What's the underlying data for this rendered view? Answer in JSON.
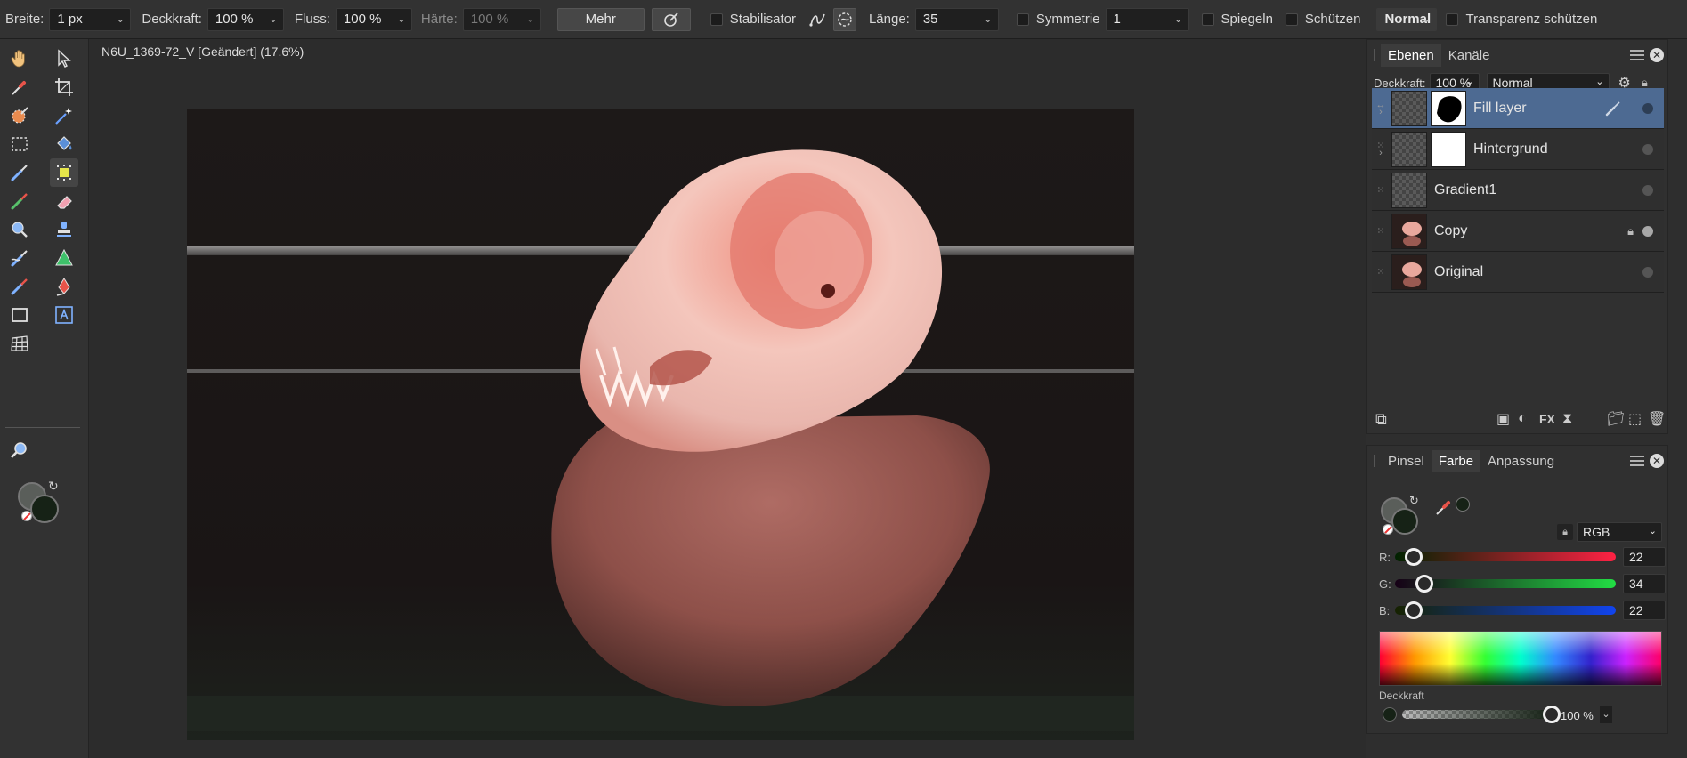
{
  "context_toolbar": {
    "width_label": "Breite:",
    "width_value": "1 px",
    "opacity_label": "Deckkraft:",
    "opacity_value": "100 %",
    "flow_label": "Fluss:",
    "flow_value": "100 %",
    "hardness_label": "Härte:",
    "hardness_value": "100 %",
    "more_label": "Mehr",
    "stabilizer_label": "Stabilisator",
    "length_label": "Länge:",
    "length_value": "35",
    "symmetry_label": "Symmetrie",
    "symmetry_value": "1",
    "mirror_label": "Spiegeln",
    "protect_label": "Schützen",
    "blend_mode": "Normal",
    "protect_alpha_label": "Transparenz schützen"
  },
  "document": {
    "title": "N6U_1369-72_V [Geändert] (17.6%)"
  },
  "layers_panel": {
    "tabs": [
      "Ebenen",
      "Kanäle"
    ],
    "opacity_label": "Deckkraft:",
    "opacity_value": "100 %",
    "blend_mode": "Normal",
    "layers": [
      {
        "name": "Fill layer",
        "selected": true,
        "visible": true,
        "locked": false
      },
      {
        "name": "Hintergrund",
        "selected": false,
        "visible": false,
        "locked": false
      },
      {
        "name": "Gradient1",
        "selected": false,
        "visible": false,
        "locked": false
      },
      {
        "name": "Copy",
        "selected": false,
        "visible": true,
        "locked": true
      },
      {
        "name": "Original",
        "selected": false,
        "visible": false,
        "locked": false
      }
    ]
  },
  "color_panel": {
    "tabs": [
      "Pinsel",
      "Farbe",
      "Anpassung"
    ],
    "model": "RGB",
    "r_label": "R:",
    "g_label": "G:",
    "b_label": "B:",
    "r_value": "22",
    "g_value": "34",
    "b_value": "22",
    "r_fraction": 0.086,
    "g_fraction": 0.133,
    "b_fraction": 0.086,
    "opacity_label": "Deckkraft",
    "opacity_value": "100 %",
    "primary_color": "#162216",
    "secondary_color": "#5a5e5a"
  },
  "colors": {
    "selection_blue": "#4d6a92",
    "accent_green": "#3ec16a"
  }
}
